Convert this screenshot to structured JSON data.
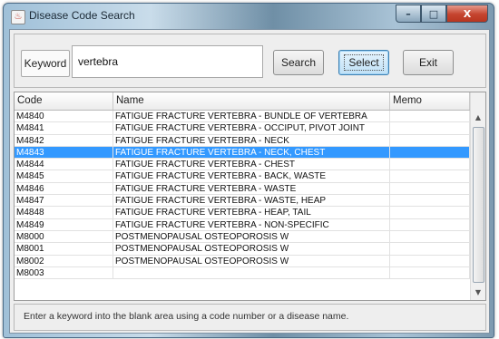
{
  "window": {
    "title": "Disease Code Search",
    "icon": "java-cup-icon",
    "controls": {
      "minimize": "–",
      "maximize": "□",
      "close": "X"
    }
  },
  "toolbar": {
    "keyword_label": "Keyword",
    "keyword_value": "vertebra",
    "search_label": "Search",
    "select_label": "Select",
    "exit_label": "Exit"
  },
  "table": {
    "columns": [
      "Code",
      "Name",
      "Memo"
    ],
    "selected_index": 3,
    "rows": [
      {
        "code": "M4840",
        "name": "FATIGUE FRACTURE VERTEBRA - BUNDLE OF VERTEBRA",
        "memo": ""
      },
      {
        "code": "M4841",
        "name": "FATIGUE FRACTURE VERTEBRA - OCCIPUT, PIVOT JOINT",
        "memo": ""
      },
      {
        "code": "M4842",
        "name": "FATIGUE FRACTURE VERTEBRA - NECK",
        "memo": ""
      },
      {
        "code": "M4843",
        "name": "FATIGUE FRACTURE VERTEBRA - NECK, CHEST",
        "memo": ""
      },
      {
        "code": "M4844",
        "name": "FATIGUE FRACTURE VERTEBRA - CHEST",
        "memo": ""
      },
      {
        "code": "M4845",
        "name": "FATIGUE FRACTURE VERTEBRA - BACK, WASTE",
        "memo": ""
      },
      {
        "code": "M4846",
        "name": "FATIGUE FRACTURE VERTEBRA - WASTE",
        "memo": ""
      },
      {
        "code": "M4847",
        "name": "FATIGUE FRACTURE VERTEBRA - WASTE, HEAP",
        "memo": ""
      },
      {
        "code": "M4848",
        "name": "FATIGUE FRACTURE VERTEBRA - HEAP, TAIL",
        "memo": ""
      },
      {
        "code": "M4849",
        "name": "FATIGUE FRACTURE VERTEBRA - NON-SPECIFIC",
        "memo": ""
      },
      {
        "code": "M8000",
        "name": "POSTMENOPAUSAL OSTEOPOROSIS W",
        "memo": ""
      },
      {
        "code": "M8001",
        "name": "POSTMENOPAUSAL OSTEOPOROSIS W",
        "memo": ""
      },
      {
        "code": "M8002",
        "name": "POSTMENOPAUSAL OSTEOPOROSIS W",
        "memo": ""
      },
      {
        "code": "M8003",
        "name": "",
        "memo": ""
      }
    ]
  },
  "status": {
    "hint": "Enter a keyword into the blank area using a code number or a disease name."
  },
  "colors": {
    "selection": "#3399ff",
    "close_button": "#c5442e"
  }
}
